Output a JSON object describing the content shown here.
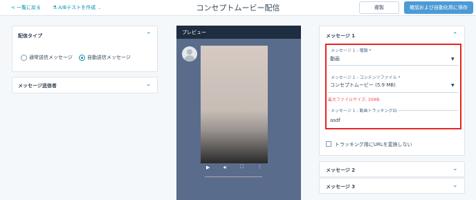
{
  "header": {
    "back_label": "< 一覧に戻る",
    "ab_label": "A/Bテストを作成",
    "title": "コンセプトムービー配信",
    "duplicate_label": "複製",
    "save_label": "確認および自動化用に保存"
  },
  "left": {
    "delivery_type_title": "配信タイプ",
    "radio_manual": "通常送信メッセージ",
    "radio_auto": "自動送信メッセージ",
    "sender_title": "メッセージ送信者"
  },
  "preview": {
    "title": "プレビュー"
  },
  "message1": {
    "title": "メッセージ 1",
    "type_label": "メッセージ 1 - 種類 *",
    "type_value": "動画",
    "file_label": "メッセージ 1 - コンテンツファイル *",
    "file_value": "コンセプトムービー (5.9 MB)",
    "file_hint": "最大ファイルサイズ: 30MB",
    "tracking_label": "メッセージ 1 - 動画トラッキングID",
    "tracking_value": "asdf",
    "checkbox_label": "トラッキング用にURLを変換しない"
  },
  "message2": {
    "title": "メッセージ 2"
  },
  "message3": {
    "title": "メッセージ 3"
  },
  "colors": {
    "accent": "#0091ae",
    "highlight": "#e8231f",
    "primary_button": "#4c9ad6"
  }
}
